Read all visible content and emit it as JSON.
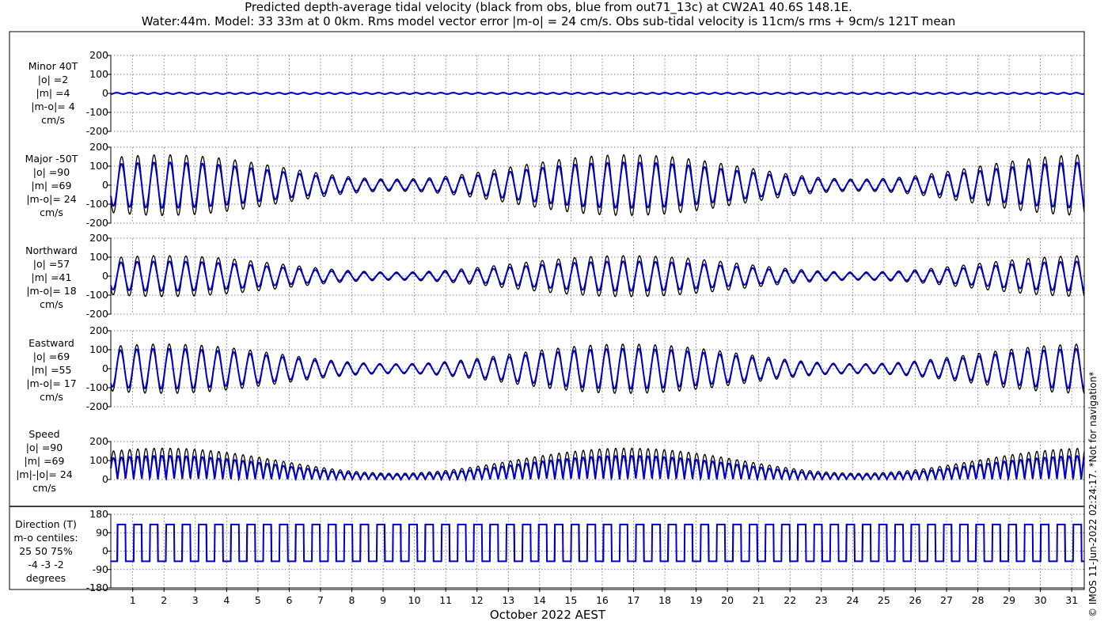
{
  "title": {
    "line1": "Predicted depth-average tidal velocity (black from obs, blue from out71_13c) at CW2A1 40.6S 148.1E.",
    "line2": "Water:44m. Model: 33 33m at 0 0km. Rms model vector error |m-o| = 24 cm/s. Obs sub-tidal velocity is 11cm/s rms + 9cm/s 121T mean"
  },
  "x_axis_label": "October 2022 AEST",
  "credit": "© IMOS 11-Jun-2022 02:24:17. *Not for navigation*",
  "colors": {
    "obs": "#000000",
    "model": "#0000cc",
    "grid": "#555555",
    "text": "#000000"
  },
  "chart_data": [
    {
      "type": "line",
      "panel": "minor",
      "label_lines": [
        "Minor 40T",
        "|o| =2",
        "|m| =4",
        "|m-o|= 4",
        "cm/s"
      ],
      "ylim": [
        -200,
        200
      ],
      "yticks": [
        200,
        100,
        0,
        -100,
        -200
      ],
      "xlim": [
        0.3,
        31.4
      ],
      "xticks": [
        1,
        2,
        3,
        4,
        5,
        6,
        7,
        8,
        9,
        10,
        11,
        12,
        13,
        14,
        15,
        16,
        17,
        18,
        19,
        20,
        21,
        22,
        23,
        24,
        25,
        26,
        27,
        28,
        29,
        30,
        31
      ],
      "series": [
        {
          "name": "obs",
          "amplitude": 2
        },
        {
          "name": "model",
          "amplitude": 4
        }
      ]
    },
    {
      "type": "line",
      "panel": "major",
      "label_lines": [
        "Major -50T",
        "|o| =90",
        "|m| =69",
        "|m-o|= 24",
        "cm/s"
      ],
      "ylim": [
        -200,
        200
      ],
      "yticks": [
        200,
        100,
        0,
        -100,
        -200
      ],
      "xlim": [
        0.3,
        31.4
      ],
      "series": [
        {
          "name": "obs",
          "peak_amplitude": 160
        },
        {
          "name": "model",
          "peak_amplitude": 120
        }
      ]
    },
    {
      "type": "line",
      "panel": "northward",
      "label_lines": [
        "Northward",
        "|o| =57",
        "|m| =41",
        "|m-o|= 18",
        "cm/s"
      ],
      "ylim": [
        -200,
        200
      ],
      "yticks": [
        200,
        100,
        0,
        -100,
        -200
      ],
      "xlim": [
        0.3,
        31.4
      ],
      "series": [
        {
          "name": "obs",
          "peak_amplitude": 108
        },
        {
          "name": "model",
          "peak_amplitude": 78
        }
      ]
    },
    {
      "type": "line",
      "panel": "eastward",
      "label_lines": [
        "Eastward",
        "|o| =69",
        "|m| =55",
        "|m-o|= 17",
        "cm/s"
      ],
      "ylim": [
        -200,
        200
      ],
      "yticks": [
        200,
        100,
        0,
        -100,
        -200
      ],
      "xlim": [
        0.3,
        31.4
      ],
      "series": [
        {
          "name": "obs",
          "peak_amplitude": 130
        },
        {
          "name": "model",
          "peak_amplitude": 105
        }
      ]
    },
    {
      "type": "line",
      "panel": "speed",
      "label_lines": [
        "Speed",
        "|o| =90",
        "|m| =69",
        "|m|-|o|= 24",
        "cm/s"
      ],
      "ylim": [
        0,
        200
      ],
      "yticks": [
        200,
        100,
        0
      ],
      "xlim": [
        0.3,
        31.4
      ],
      "series": [
        {
          "name": "obs",
          "peak": 165
        },
        {
          "name": "model",
          "peak": 125
        }
      ]
    },
    {
      "type": "line",
      "panel": "direction",
      "label_lines": [
        "Direction (T)",
        "m-o centiles:",
        "25  50  75%",
        "-4 -3 -2",
        "degrees"
      ],
      "ylim": [
        -180,
        180
      ],
      "yticks": [
        180,
        90,
        0,
        -90,
        -180
      ],
      "xlim": [
        0.3,
        31.4
      ],
      "series": [
        {
          "name": "obs",
          "levels": [
            130,
            -50
          ]
        },
        {
          "name": "model",
          "levels": [
            130,
            -50
          ]
        }
      ]
    }
  ]
}
